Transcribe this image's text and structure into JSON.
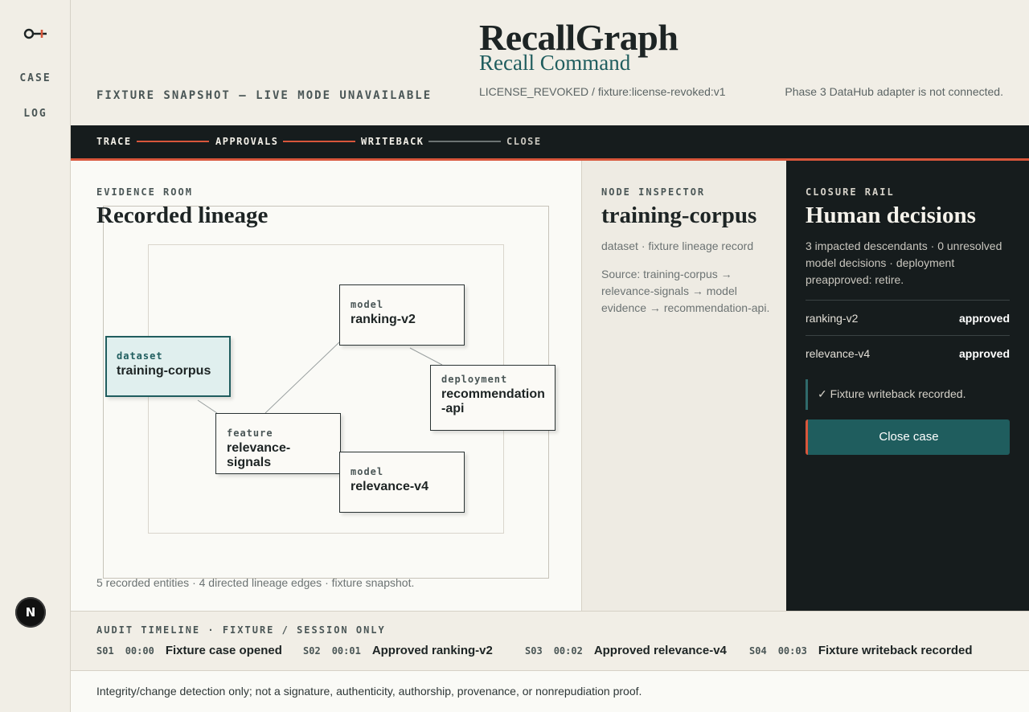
{
  "rail": {
    "logo_icon": "key-icon",
    "nav": [
      {
        "label": "CASE"
      },
      {
        "label": "LOG"
      }
    ],
    "badge": "N"
  },
  "header": {
    "snapshot": "FIXTURE SNAPSHOT — LIVE MODE UNAVAILABLE",
    "brand": "RecallGraph",
    "subtitle": "Recall Command",
    "license": "LICENSE_REVOKED / fixture:license-revoked:v1",
    "phase_note": "Phase 3 DataHub adapter is not connected."
  },
  "steps": [
    {
      "label": "TRACE"
    },
    {
      "label": "APPROVALS"
    },
    {
      "label": "WRITEBACK"
    },
    {
      "label": "CLOSE"
    }
  ],
  "colors": {
    "accent": "#d8563b",
    "teal": "#1f5d5e",
    "dark": "#161c1d",
    "pending_line": "#6c7373"
  },
  "evidence": {
    "eyebrow": "EVIDENCE ROOM",
    "title": "Recorded lineage",
    "nodes": [
      {
        "kind": "dataset",
        "name": "training-corpus"
      },
      {
        "kind": "model",
        "name": "ranking-v2"
      },
      {
        "kind": "deployment",
        "name": "recommendation-api"
      },
      {
        "kind": "feature",
        "name": "relevance-signals"
      },
      {
        "kind": "model",
        "name": "relevance-v4"
      }
    ],
    "caption": "5 recorded entities · 4 directed lineage edges · fixture snapshot."
  },
  "inspector": {
    "eyebrow": "NODE INSPECTOR",
    "title": "training-corpus",
    "meta": "dataset · fixture lineage record",
    "source": "Source: training-corpus → relevance-signals → model evidence → recommendation-api."
  },
  "closure": {
    "eyebrow": "CLOSURE RAIL",
    "title": "Human decisions",
    "summary": "3 impacted descendants · 0 unresolved model decisions · deployment preapproved: retire.",
    "decisions": [
      {
        "name": "ranking-v2",
        "status": "approved"
      },
      {
        "name": "relevance-v4",
        "status": "approved"
      }
    ],
    "writeback_note": "✓ Fixture writeback recorded.",
    "close_button": "Close case"
  },
  "audit": {
    "eyebrow": "AUDIT TIMELINE · FIXTURE / SESSION ONLY",
    "events": [
      {
        "id": "S01",
        "time": "00:00",
        "text": "Fixture case opened"
      },
      {
        "id": "S02",
        "time": "00:01",
        "text": "Approved ranking-v2"
      },
      {
        "id": "S03",
        "time": "00:02",
        "text": "Approved relevance-v4"
      },
      {
        "id": "S04",
        "time": "00:03",
        "text": "Fixture writeback recorded"
      }
    ]
  },
  "footer": {
    "note": "Integrity/change detection only; not a signature, authenticity, authorship, provenance, or nonrepudiation proof."
  }
}
